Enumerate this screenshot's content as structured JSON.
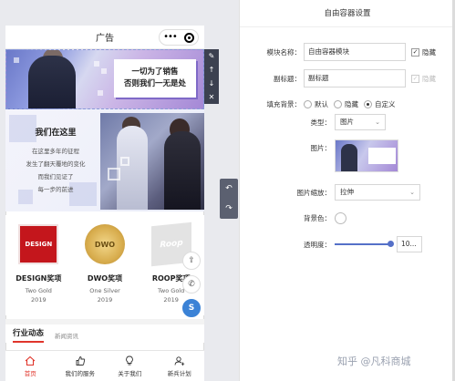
{
  "preview": {
    "title": "广告",
    "banner1": {
      "line1": "一切为了销售",
      "line2": "否则我们一无是处"
    },
    "section2": {
      "title": "我们在这里",
      "lines": [
        "在这里多年的征程",
        "发生了翻天覆地的变化",
        "而我们见证了",
        "每一步的前进"
      ]
    },
    "awards": [
      {
        "logo": "DESIGN",
        "name": "DESIGN奖项",
        "medal": "Two Gold",
        "year": "2019"
      },
      {
        "logo": "DWO",
        "name": "DWO奖项",
        "medal": "One Silver",
        "year": "2019"
      },
      {
        "logo": "Roop",
        "name": "ROOP奖项",
        "medal": "Two Gold",
        "year": "2019"
      }
    ],
    "news_tabs": {
      "active": "行业动态",
      "inactive": "新闻资讯"
    },
    "tabbar": [
      {
        "label": "首页",
        "icon": "home-icon"
      },
      {
        "label": "我们的服务",
        "icon": "thumbs-up-icon"
      },
      {
        "label": "关于我们",
        "icon": "lightbulb-icon"
      },
      {
        "label": "新兵计划",
        "icon": "add-user-icon"
      }
    ],
    "accent": "#e0352b"
  },
  "panel": {
    "title": "自由容器设置",
    "module_name": {
      "label": "模块名称：",
      "value": "自由容器模块",
      "hide_label": "隐藏",
      "hidden": true
    },
    "subtitle": {
      "label": "副标题：",
      "value": "副标题",
      "hide_label": "隐藏",
      "hidden": true
    },
    "fill_bg": {
      "label": "填充背景：",
      "options": [
        "默认",
        "隐藏",
        "自定义"
      ],
      "selected": "自定义"
    },
    "type": {
      "label": "类型：",
      "value": "图片"
    },
    "image": {
      "label": "图片："
    },
    "image_scale": {
      "label": "图片缩放：",
      "value": "拉伸"
    },
    "bg_color": {
      "label": "背景色："
    },
    "opacity": {
      "label": "透明度：",
      "value": "10..."
    }
  },
  "watermark": "知乎 @凡科商城"
}
